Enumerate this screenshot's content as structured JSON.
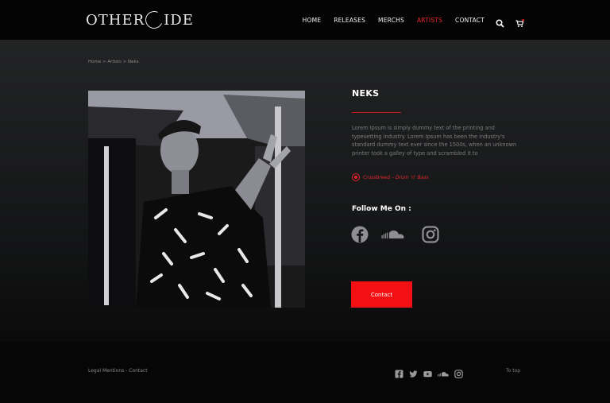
{
  "header": {
    "logo_text_left": "OTHER",
    "logo_text_right": "IDE",
    "nav": [
      {
        "label": "HOME"
      },
      {
        "label": "RELEASES"
      },
      {
        "label": "MERCHS"
      },
      {
        "label": "ARTISTS"
      },
      {
        "label": "CONTACT"
      }
    ],
    "active_nav": "ARTISTS",
    "icons": [
      "search-icon",
      "cart-icon"
    ],
    "accent_color": "#e8252a"
  },
  "breadcrumb": "Home > Artists > Neks",
  "artist": {
    "name": "NEKS",
    "bio": "Lorem Ipsum is simply dummy text of the printing and typesetting industry. Lorem Ipsum has been the industry's standard dummy text ever since the 1500s, when an unknown printer took a galley of type and scrambled it to",
    "genre": "Crossbreed – Drum 'n' Bass"
  },
  "follow": {
    "title": "Follow Me On :",
    "icons": [
      "facebook-icon",
      "soundcloud-icon",
      "instagram-icon"
    ]
  },
  "contact_button": "Contact",
  "footer": {
    "left": "Legal Mentions - Contact",
    "icons": [
      "facebook-icon",
      "twitter-icon",
      "youtube-icon",
      "soundcloud-icon",
      "instagram-icon"
    ],
    "to_top": "To top"
  }
}
